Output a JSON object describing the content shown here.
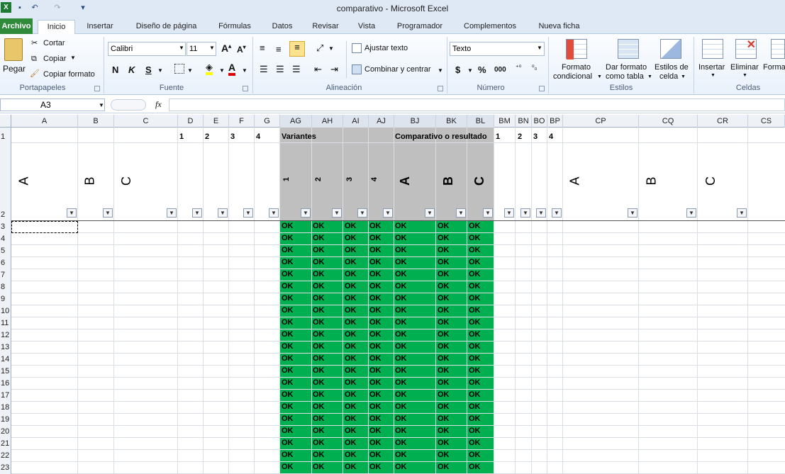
{
  "window": {
    "title": "comparativo  -  Microsoft Excel"
  },
  "tabs": [
    "Archivo",
    "Inicio",
    "Insertar",
    "Diseño de página",
    "Fórmulas",
    "Datos",
    "Revisar",
    "Vista",
    "Programador",
    "Complementos",
    "Nueva ficha"
  ],
  "clipboard": {
    "paste": "Pegar",
    "cut": "Cortar",
    "copy": "Copiar",
    "format_painter": "Copiar formato",
    "group": "Portapapeles"
  },
  "font": {
    "name": "Calibri",
    "size": "11",
    "bold": "N",
    "italic": "K",
    "underline": "S",
    "group": "Fuente"
  },
  "alignment": {
    "wrap": "Ajustar texto",
    "merge": "Combinar y centrar",
    "group": "Alineación"
  },
  "number": {
    "format": "Texto",
    "currency": "$",
    "percent": "%",
    "thousands": "000",
    "group": "Número"
  },
  "styles": {
    "conditional": "Formato",
    "conditional2": "condicional",
    "table": "Dar formato",
    "table2": "como tabla",
    "cell": "Estilos de",
    "cell2": "celda",
    "group": "Estilos"
  },
  "cells": {
    "insert": "Insertar",
    "delete": "Eliminar",
    "format": "Forma",
    "group": "Celdas"
  },
  "formula_bar": {
    "name_box": "A3",
    "fx": "fx",
    "value": ""
  },
  "columns": [
    "A",
    "B",
    "C",
    "D",
    "E",
    "F",
    "G",
    "AG",
    "AH",
    "AI",
    "AJ",
    "BJ",
    "BK",
    "BL",
    "BM",
    "BN",
    "BO",
    "BP",
    "CP",
    "CQ",
    "CR",
    "CS"
  ],
  "row1": {
    "d": "1",
    "e": "2",
    "f": "3",
    "g": "4",
    "variants": "Variantes",
    "comparative": "Comparativo o resultado",
    "bm": "1",
    "bn": "2",
    "bo": "3",
    "bp": "4"
  },
  "row2": {
    "a": "A",
    "b": "B",
    "c": "C",
    "ag": "1",
    "ah": "2",
    "ai": "3",
    "aj": "4",
    "bj": "A",
    "bk": "B",
    "bl": "C",
    "cp": "A",
    "cq": "B",
    "cr": "C"
  },
  "rows": [
    "1",
    "2",
    "3",
    "4",
    "5",
    "6",
    "7",
    "8",
    "9",
    "10",
    "11",
    "12",
    "13",
    "14",
    "15",
    "16",
    "17",
    "18",
    "19",
    "20",
    "21",
    "22",
    "23"
  ],
  "ok": "OK",
  "colors": {
    "green": "#00b050",
    "gray": "#bfbfbf",
    "archivo": "#2f8a3a"
  }
}
